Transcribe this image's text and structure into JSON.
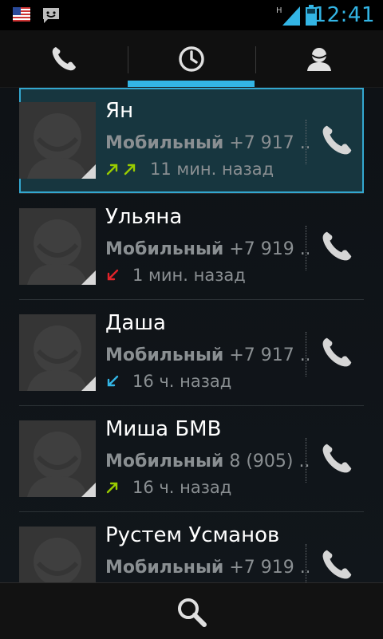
{
  "status_bar": {
    "time": "12:41",
    "network_label": "H",
    "icons": [
      "us-flag-icon",
      "message-icon",
      "signal-icon",
      "battery-icon"
    ],
    "accent_color": "#33b5e5"
  },
  "tabs": [
    {
      "name": "phone-icon",
      "selected": false
    },
    {
      "name": "clock-icon",
      "selected": true
    },
    {
      "name": "contacts-icon",
      "selected": false
    }
  ],
  "calls": [
    {
      "name": "Ян",
      "type": "Мобильный",
      "number": "+7 917 ...",
      "time": "11 мин. назад",
      "direction": "outgoing",
      "count": 2,
      "selected": true
    },
    {
      "name": "Ульяна",
      "type": "Мобильный",
      "number": "+7 919 ...",
      "time": "1 мин. назад",
      "direction": "missed",
      "count": 1,
      "selected": false
    },
    {
      "name": "Даша",
      "type": "Мобильный",
      "number": "+7 917 ...",
      "time": "16 ч. назад",
      "direction": "incoming",
      "count": 1,
      "selected": false
    },
    {
      "name": "Миша БМВ",
      "type": "Мобильный",
      "number": "8 (905) ...",
      "time": "16 ч. назад",
      "direction": "outgoing",
      "count": 1,
      "selected": false
    },
    {
      "name": "Рустем Усманов",
      "type": "Мобильный",
      "number": "+7 919 ...",
      "time": "",
      "direction": "",
      "count": 0,
      "selected": false
    }
  ],
  "colors": {
    "outgoing": "#99cc00",
    "missed": "#e0242a",
    "incoming": "#33b5e5"
  },
  "bottom_bar": {
    "icon": "search-icon"
  }
}
